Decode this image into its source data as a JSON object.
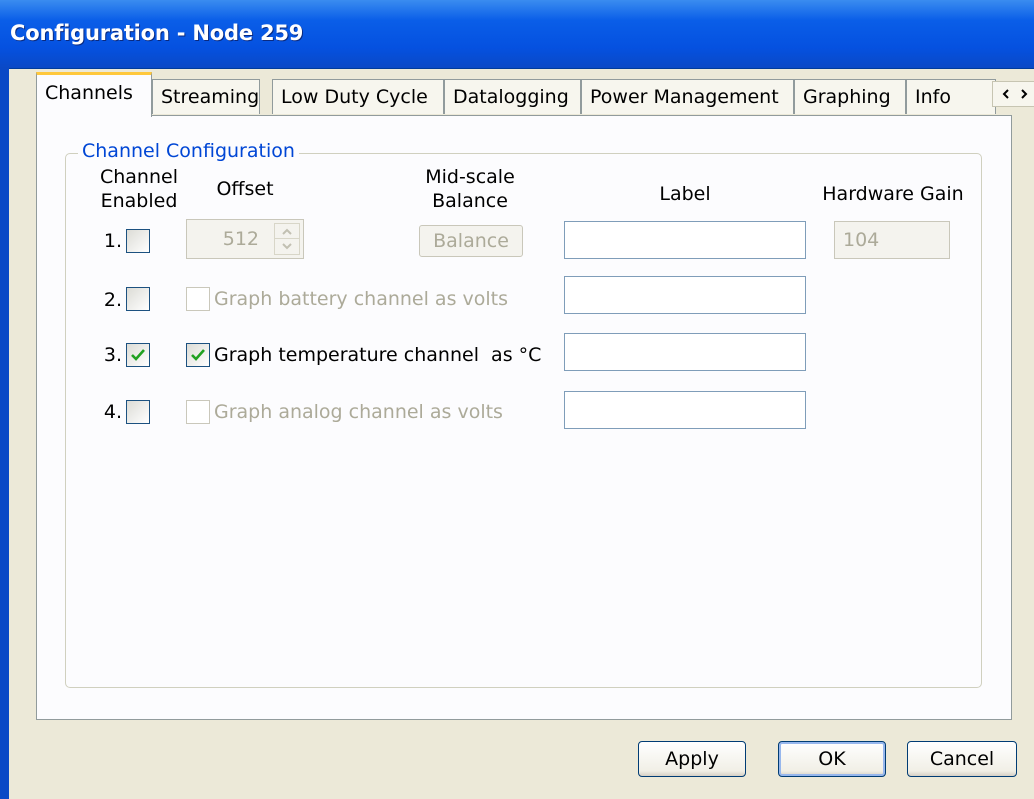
{
  "window": {
    "title": "Configuration - Node 259"
  },
  "tabs": [
    {
      "label": "Channels",
      "active": true
    },
    {
      "label": "Streaming"
    },
    {
      "label": "Low Duty Cycle"
    },
    {
      "label": "Datalogging"
    },
    {
      "label": "Power Management"
    },
    {
      "label": "Graphing"
    },
    {
      "label": "Info"
    }
  ],
  "group": {
    "title": "Channel Configuration",
    "headers": {
      "enabled": "Channel\nEnabled",
      "offset": "Offset",
      "balance": "Mid-scale\nBalance",
      "label": "Label",
      "gain": "Hardware Gain"
    }
  },
  "channels": [
    {
      "number": "1.",
      "enabled": false,
      "offset": "512",
      "balance_button": "Balance",
      "label": "",
      "gain": "104"
    },
    {
      "number": "2.",
      "enabled": false,
      "option": "Graph battery channel as volts",
      "option_checked": false,
      "option_enabled": false,
      "label": ""
    },
    {
      "number": "3.",
      "enabled": true,
      "option": "Graph temperature channel  as °C",
      "option_checked": true,
      "option_enabled": true,
      "label": ""
    },
    {
      "number": "4.",
      "enabled": false,
      "option": "Graph analog channel as volts",
      "option_checked": false,
      "option_enabled": false,
      "label": ""
    }
  ],
  "buttons": {
    "apply": "Apply",
    "ok": "OK",
    "cancel": "Cancel"
  },
  "colors": {
    "titlebar": "#0551e0",
    "group_title": "#0046d5",
    "active_tab_accent": "#ffc83c",
    "check": "#21a121"
  }
}
